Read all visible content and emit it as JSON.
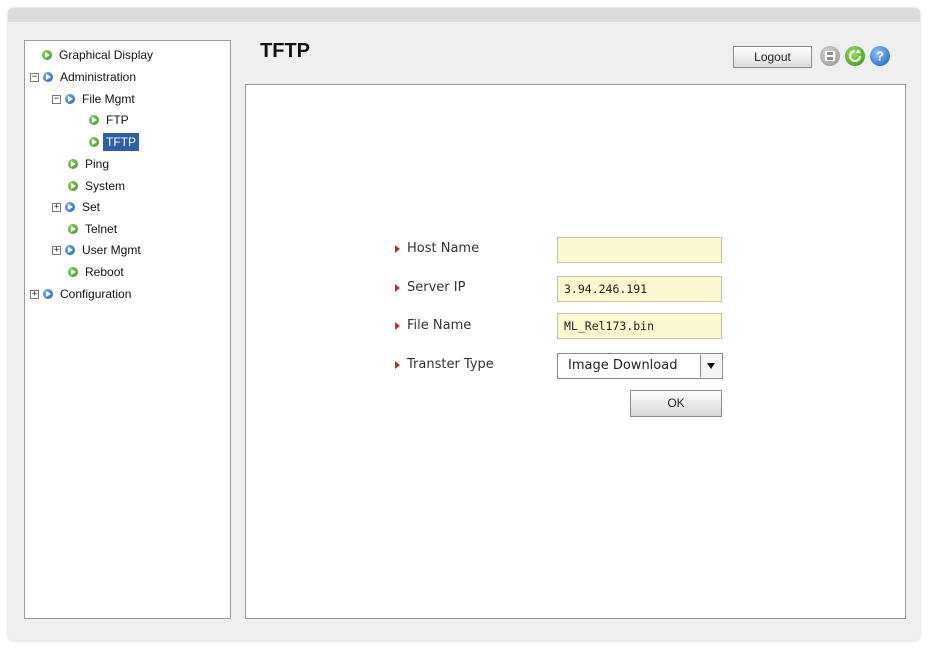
{
  "header": {
    "page_title": "TFTP",
    "logout_label": "Logout"
  },
  "toolbar_icons": [
    "save-icon",
    "refresh-icon",
    "help-icon"
  ],
  "sidebar": {
    "items": [
      {
        "label": "Graphical Display",
        "icon": "green-arrow",
        "expander": ""
      },
      {
        "label": "Administration",
        "icon": "blue-arrow",
        "expander": "−"
      },
      {
        "label": "File Mgmt",
        "icon": "blue-arrow",
        "expander": "−"
      },
      {
        "label": "FTP",
        "icon": "green-arrow",
        "expander": ""
      },
      {
        "label": "TFTP",
        "icon": "green-arrow",
        "expander": "",
        "selected": true
      },
      {
        "label": "Ping",
        "icon": "green-arrow",
        "expander": ""
      },
      {
        "label": "System",
        "icon": "green-arrow",
        "expander": ""
      },
      {
        "label": "Set",
        "icon": "blue-arrow",
        "expander": "+"
      },
      {
        "label": "Telnet",
        "icon": "green-arrow",
        "expander": ""
      },
      {
        "label": "User Mgmt",
        "icon": "blue-arrow",
        "expander": "+"
      },
      {
        "label": "Reboot",
        "icon": "green-arrow",
        "expander": ""
      },
      {
        "label": "Configuration",
        "icon": "blue-arrow",
        "expander": "+"
      }
    ]
  },
  "form": {
    "host_name": {
      "label": "Host Name",
      "value": ""
    },
    "server_ip": {
      "label": "Server IP",
      "value": "3.94.246.191"
    },
    "file_name": {
      "label": "File Name",
      "value": "ML_Rel173.bin"
    },
    "transfer_type": {
      "label": "Transter Type",
      "value": "Image Download"
    },
    "ok_label": "OK"
  },
  "colors": {
    "selected_bg": "#2f5ea8",
    "field_bg": "#fbf7cf",
    "label_arrow": "#c0302a"
  }
}
